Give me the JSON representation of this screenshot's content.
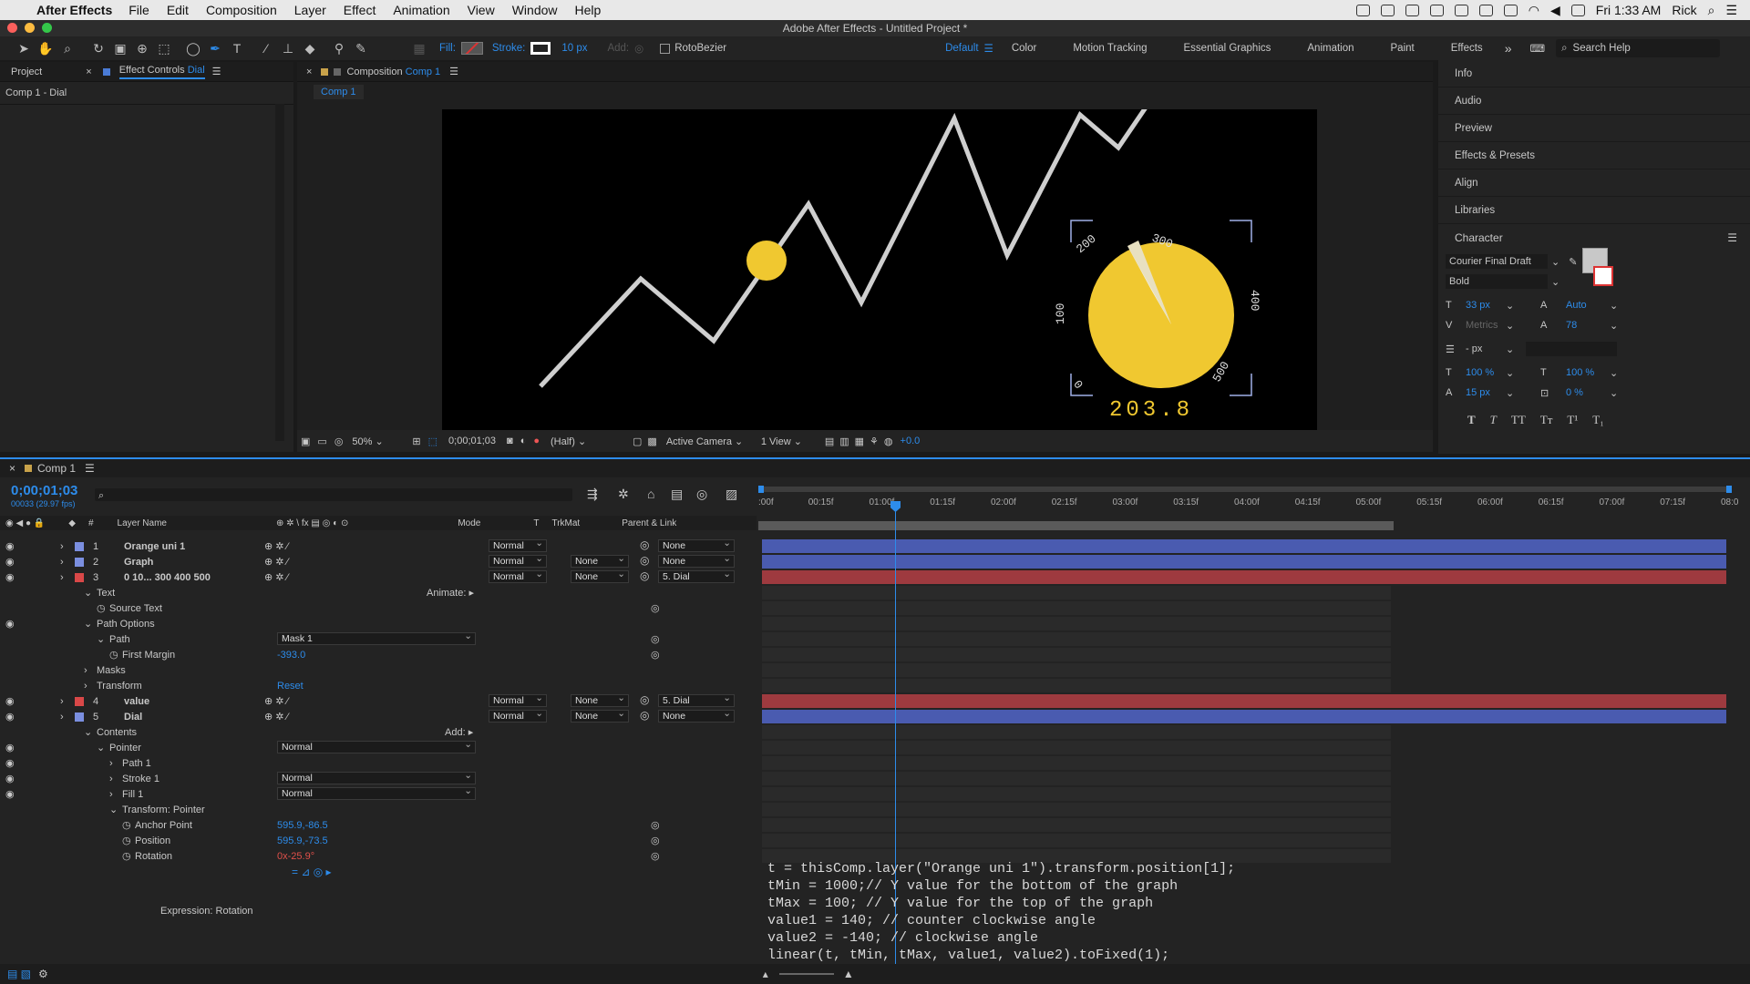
{
  "menubar": {
    "app": "After Effects",
    "items": [
      "File",
      "Edit",
      "Composition",
      "Layer",
      "Effect",
      "Animation",
      "View",
      "Window",
      "Help"
    ],
    "clock": "Fri 1:33 AM",
    "user": "Rick"
  },
  "window_title": "Adobe After Effects - Untitled Project *",
  "toolbar": {
    "fill_label": "Fill:",
    "stroke_label": "Stroke:",
    "stroke_width": "10 px",
    "add_label": "Add:",
    "rotobezier": "RotoBezier",
    "workspaces": [
      "Default",
      "Color",
      "Motion Tracking",
      "Essential Graphics",
      "Animation",
      "Paint",
      "Effects"
    ],
    "search_placeholder": "Search Help"
  },
  "left_panel": {
    "tab_project": "Project",
    "tab_effect_controls": "Effect Controls",
    "tab_effect_target": "Dial",
    "subtitle": "Comp 1 - Dial"
  },
  "comp_panel": {
    "tab_label": "Composition",
    "tab_name": "Comp 1",
    "subtab": "Comp 1",
    "dial_labels": [
      "100",
      "200",
      "300",
      "400",
      "500",
      "0"
    ],
    "dial_value": "203.8",
    "footer": {
      "zoom": "50%",
      "timecode": "0;00;01;03",
      "resolution": "(Half)",
      "camera": "Active Camera",
      "views": "1 View",
      "exposure": "+0.0"
    }
  },
  "right_panel": {
    "items": [
      "Info",
      "Audio",
      "Preview",
      "Effects & Presets",
      "Align",
      "Libraries"
    ],
    "character": {
      "title": "Character",
      "font": "Courier Final Draft",
      "style": "Bold",
      "size": "33 px",
      "leading": "Auto",
      "kerning": "Metrics",
      "tracking": "78",
      "stroke_width": "- px",
      "vscale": "100 %",
      "hscale": "100 %",
      "baseline": "15 px",
      "tsume": "0 %",
      "style_buttons": [
        "T",
        "T",
        "TT",
        "Tт",
        "T¹",
        "T₁"
      ],
      "fill_color": "#c8c8c8"
    }
  },
  "timeline": {
    "comp_name": "Comp 1",
    "timecode": "0;00;01;03",
    "frame_info": "00033 (29.97 fps)",
    "columns": {
      "num": "#",
      "layer_name": "Layer Name",
      "mode": "Mode",
      "t": "T",
      "trkmat": "TrkMat",
      "parent": "Parent & Link"
    },
    "ruler": [
      ":00f",
      "00:15f",
      "01:00f",
      "01:15f",
      "02:00f",
      "02:15f",
      "03:00f",
      "03:15f",
      "04:00f",
      "04:15f",
      "05:00f",
      "05:15f",
      "06:00f",
      "06:15f",
      "07:00f",
      "07:15f",
      "08:0"
    ],
    "layers": [
      {
        "num": "1",
        "name": "Orange uni 1",
        "mode": "Normal",
        "trkmat": "",
        "parent": "None",
        "color": "#7b8fe0"
      },
      {
        "num": "2",
        "name": "Graph",
        "mode": "Normal",
        "trkmat": "None",
        "parent": "None",
        "color": "#7b8fe0"
      },
      {
        "num": "3",
        "name": "0   10...   300   400   500",
        "mode": "Normal",
        "trkmat": "None",
        "parent": "5. Dial",
        "color": "#d94848"
      },
      {
        "num": "4",
        "name": "value",
        "mode": "Normal",
        "trkmat": "None",
        "parent": "5. Dial",
        "color": "#d94848"
      },
      {
        "num": "5",
        "name": "Dial",
        "mode": "Normal",
        "trkmat": "None",
        "parent": "None",
        "color": "#7b8fe0"
      }
    ],
    "props": {
      "text": "Text",
      "animate": "Animate:",
      "source_text": "Source Text",
      "path_options": "Path Options",
      "path": "Path",
      "path_value": "Mask 1",
      "first_margin": "First Margin",
      "first_margin_value": "-393.0",
      "masks": "Masks",
      "transform": "Transform",
      "reset": "Reset",
      "contents": "Contents",
      "add": "Add:",
      "pointer": "Pointer",
      "pointer_mode": "Normal",
      "path1": "Path 1",
      "stroke1": "Stroke 1",
      "stroke1_mode": "Normal",
      "fill1": "Fill 1",
      "fill1_mode": "Normal",
      "transform_pointer": "Transform: Pointer",
      "anchor_point": "Anchor Point",
      "anchor_value": "595.9,-86.5",
      "position": "Position",
      "position_value": "595.9,-73.5",
      "rotation": "Rotation",
      "rotation_value": "0x-25.9°",
      "expression_label": "Expression: Rotation"
    },
    "expression": "t = thisComp.layer(\"Orange uni 1\").transform.position[1];\ntMin = 1000;// Y value for the bottom of the graph\ntMax = 100; // Y value for the top of the graph\nvalue1 = 140; // counter clockwise angle\nvalue2 = -140; // clockwise angle\nlinear(t, tMin, tMax, value1, value2).toFixed(1);"
  }
}
